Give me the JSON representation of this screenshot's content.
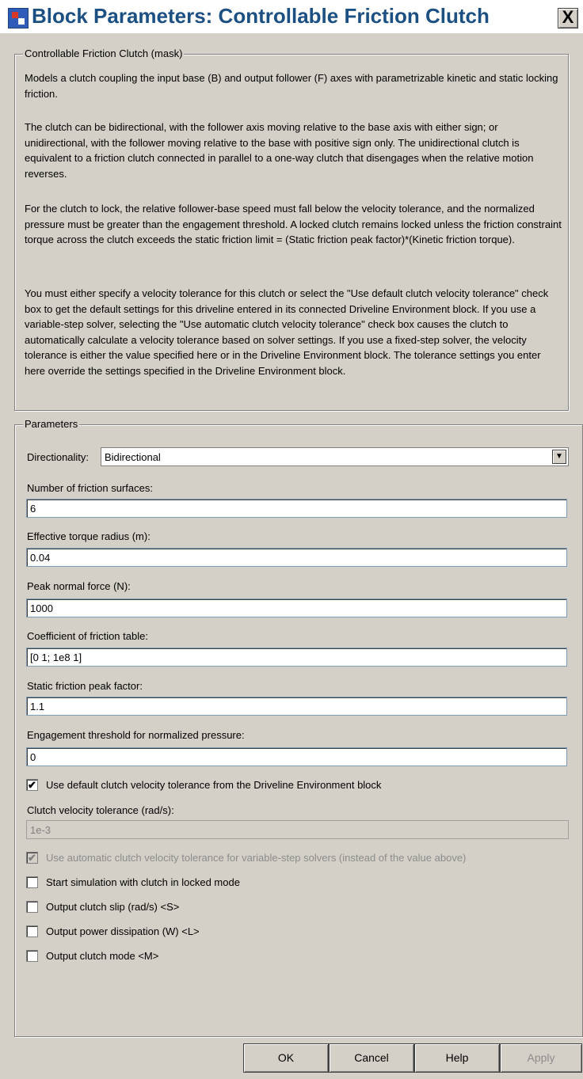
{
  "window": {
    "title": "Block Parameters: Controllable Friction Clutch",
    "close_label": "X"
  },
  "description": {
    "group_label": "Controllable Friction Clutch (mask)",
    "paragraphs": [
      "Models a clutch coupling the input base (B) and output follower (F) axes with parametrizable kinetic and static locking friction.",
      "The clutch can be bidirectional, with the follower axis moving relative to the base axis with either sign; or unidirectional, with the follower moving relative to the base with positive sign only. The unidirectional clutch is equivalent to a friction clutch connected in parallel to a one-way clutch that disengages when the relative motion reverses.",
      "For the clutch to lock, the relative follower-base speed must fall below the velocity tolerance, and the normalized pressure must be greater than the engagement threshold. A locked clutch remains locked unless the friction constraint torque across the clutch exceeds the static friction limit = (Static friction peak factor)*(Kinetic friction torque).",
      "You must either specify a velocity tolerance for this clutch or select the \"Use default clutch velocity tolerance\" check box to get the default settings for this driveline entered in its connected Driveline Environment block. If you use a variable-step solver, selecting the \"Use automatic clutch velocity tolerance\" check box causes the clutch to automatically calculate a velocity tolerance based on solver settings. If you use a fixed-step solver, the velocity tolerance is either the value specified here or in the Driveline Environment block. The tolerance settings you enter here override the settings specified in the Driveline Environment block."
    ]
  },
  "parameters": {
    "group_label": "Parameters",
    "directionality": {
      "label": "Directionality:",
      "value": "Bidirectional"
    },
    "fields": [
      {
        "label": "Number of friction surfaces:",
        "value": "6"
      },
      {
        "label": "Effective torque radius (m):",
        "value": "0.04"
      },
      {
        "label": "Peak normal force (N):",
        "value": "1000"
      },
      {
        "label": "Coefficient of friction table:",
        "value": "[0 1; 1e8 1]"
      },
      {
        "label": "Static friction peak factor:",
        "value": "1.1"
      },
      {
        "label": "Engagement threshold for normalized pressure:",
        "value": "0"
      }
    ],
    "use_default_tolerance": {
      "label": "Use default clutch velocity tolerance from the Driveline Environment block",
      "checked": "✔"
    },
    "velocity_tolerance": {
      "label": "Clutch velocity tolerance (rad/s):",
      "value": "1e-3"
    },
    "use_automatic_tolerance": {
      "label": "Use automatic clutch velocity tolerance for variable-step solvers (instead of the value above)",
      "checked": "✔"
    },
    "checkboxes": [
      {
        "label": "Start simulation with clutch in locked mode"
      },
      {
        "label": "Output clutch slip (rad/s) <S>"
      },
      {
        "label": "Output power dissipation (W) <L>"
      },
      {
        "label": "Output clutch mode <M>"
      }
    ]
  },
  "buttons": {
    "ok": "OK",
    "cancel": "Cancel",
    "help": "Help",
    "apply": "Apply"
  },
  "icons": {
    "app": "simulink-block-icon",
    "dropdown": "chevron-down-icon",
    "close": "close-icon"
  }
}
